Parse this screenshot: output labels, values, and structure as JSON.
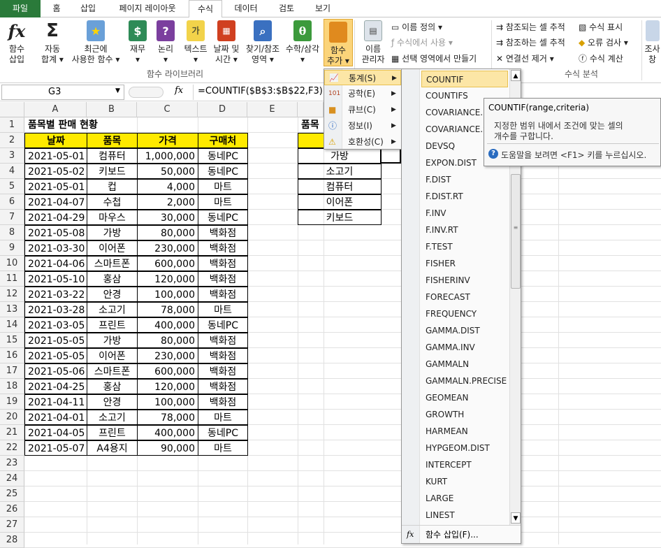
{
  "tabs": [
    "파일",
    "홈",
    "삽입",
    "페이지 레이아웃",
    "수식",
    "데이터",
    "검토",
    "보기"
  ],
  "ribbon": {
    "insert_function": [
      "함수",
      "삽입"
    ],
    "autosum": [
      "자동",
      "합계 ▾"
    ],
    "recent": [
      "최근에",
      "사용한 함수 ▾"
    ],
    "financial": [
      "재무",
      "▾"
    ],
    "logical": [
      "논리",
      "▾"
    ],
    "text": [
      "텍스트",
      "▾"
    ],
    "datetime": [
      "날짜 및",
      "시간 ▾"
    ],
    "lookup": [
      "찾기/참조",
      "영역 ▾"
    ],
    "math": [
      "수학/삼각",
      "▾"
    ],
    "more": [
      "함수",
      "추가 ▾"
    ],
    "name_manager": [
      "이름",
      "관리자"
    ],
    "define_name": "이름 정의 ▾",
    "use_in_formula": "수식에서 사용 ▾",
    "create_from_selection": "선택 영역에서 만들기",
    "trace_precedents": "참조되는 셀 추적",
    "trace_dependents": "참조하는 셀 추적",
    "remove_arrows": "연결선 제거 ▾",
    "show_formulas": "수식 표시",
    "error_checking": "오류 검사 ▾",
    "evaluate": "수식 계산",
    "watch": [
      "조사",
      "창"
    ],
    "group_library": "함수 라이브러리",
    "group_audit": "수식 분석",
    "icon_colors": {
      "financial": "#2e8b57",
      "logical": "#7b3f9e",
      "text": "#e0b000",
      "datetime": "#d04020",
      "lookup": "#3a70c0",
      "math": "#3c9a3c",
      "more": "#e08a1e"
    }
  },
  "formula_bar": {
    "name_box": "G3",
    "fx": "fx",
    "formula": "=COUNTIF($B$3:$B$22,F3)"
  },
  "columns": [
    "A",
    "B",
    "C",
    "D",
    "E"
  ],
  "rows": [
    "1",
    "2",
    "3",
    "4",
    "5",
    "6",
    "7",
    "8",
    "9",
    "10",
    "11",
    "12",
    "13",
    "14",
    "15",
    "16",
    "17",
    "18",
    "19",
    "20",
    "21",
    "22",
    "23",
    "24",
    "25",
    "26",
    "27",
    "28"
  ],
  "sheet": {
    "title": "품목별 판매 현황",
    "headers": [
      "날짜",
      "품목",
      "가격",
      "구매처"
    ],
    "data": [
      [
        "2021-05-01",
        "컴퓨터",
        "1,000,000",
        "동네PC"
      ],
      [
        "2021-05-02",
        "키보드",
        "50,000",
        "동네PC"
      ],
      [
        "2021-05-01",
        "컵",
        "4,000",
        "마트"
      ],
      [
        "2021-04-07",
        "수첩",
        "2,000",
        "마트"
      ],
      [
        "2021-04-29",
        "마우스",
        "30,000",
        "동네PC"
      ],
      [
        "2021-05-08",
        "가방",
        "80,000",
        "백화점"
      ],
      [
        "2021-03-30",
        "이어폰",
        "230,000",
        "백화점"
      ],
      [
        "2021-04-06",
        "스마트폰",
        "600,000",
        "백화점"
      ],
      [
        "2021-05-10",
        "홍삼",
        "120,000",
        "백화점"
      ],
      [
        "2021-03-22",
        "안경",
        "100,000",
        "백화점"
      ],
      [
        "2021-03-28",
        "소고기",
        "78,000",
        "마트"
      ],
      [
        "2021-03-05",
        "프린트",
        "400,000",
        "동네PC"
      ],
      [
        "2021-05-05",
        "가방",
        "80,000",
        "백화점"
      ],
      [
        "2021-05-05",
        "이어폰",
        "230,000",
        "백화점"
      ],
      [
        "2021-05-06",
        "스마트폰",
        "600,000",
        "백화점"
      ],
      [
        "2021-04-25",
        "홍삼",
        "120,000",
        "백화점"
      ],
      [
        "2021-04-11",
        "안경",
        "100,000",
        "백화점"
      ],
      [
        "2021-04-01",
        "소고기",
        "78,000",
        "마트"
      ],
      [
        "2021-04-05",
        "프린트",
        "400,000",
        "동네PC"
      ],
      [
        "2021-05-07",
        "A4용지",
        "90,000",
        "마트"
      ]
    ],
    "f_title": "품목",
    "f_items": [
      "가방",
      "소고기",
      "컴퓨터",
      "이어폰",
      "키보드"
    ]
  },
  "more_menu": [
    "통계(S)",
    "공학(E)",
    "큐브(C)",
    "정보(I)",
    "호환성(C)"
  ],
  "func_list": [
    "COUNTIF",
    "COUNTIFS",
    "COVARIANCE.P",
    "COVARIANCE.S",
    "DEVSQ",
    "EXPON.DIST",
    "F.DIST",
    "F.DIST.RT",
    "F.INV",
    "F.INV.RT",
    "F.TEST",
    "FISHER",
    "FISHERINV",
    "FORECAST",
    "FREQUENCY",
    "GAMMA.DIST",
    "GAMMA.INV",
    "GAMMALN",
    "GAMMALN.PRECISE",
    "GEOMEAN",
    "GROWTH",
    "HARMEAN",
    "HYPGEOM.DIST",
    "INTERCEPT",
    "KURT",
    "LARGE",
    "LINEST"
  ],
  "insert_function_item": "함수 삽입(F)...",
  "tooltip": {
    "title": "COUNTIF(range,criteria)",
    "desc1": "지정한 범위 내에서 조건에 맞는 셀의",
    "desc2": "개수를 구합니다.",
    "help": "도움말을 보려면 <F1> 키를 누르십시오."
  }
}
